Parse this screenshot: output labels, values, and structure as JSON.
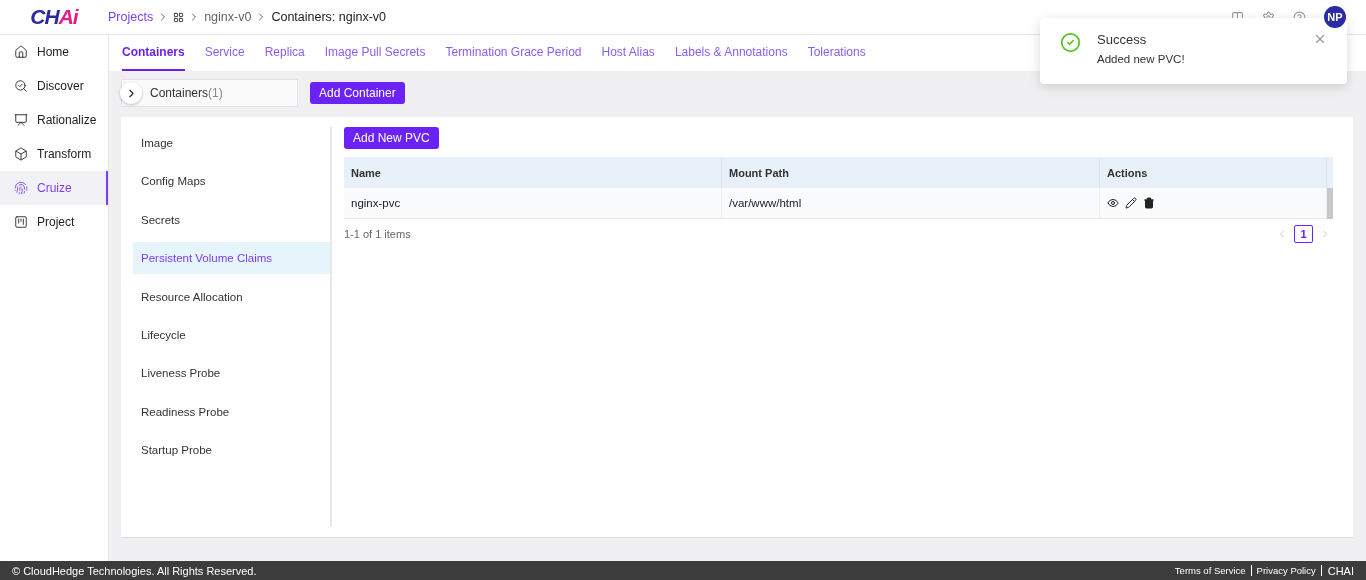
{
  "logo": {
    "main": "CH",
    "accent": "Ai"
  },
  "breadcrumb": [
    {
      "kind": "link",
      "label": "Projects"
    },
    {
      "kind": "grid"
    },
    {
      "kind": "muted",
      "label": "nginx-v0"
    },
    {
      "kind": "current",
      "label": "Containers: nginx-v0"
    }
  ],
  "user": {
    "initials": "NP"
  },
  "sidebar": {
    "items": [
      {
        "kind": "home",
        "label": "Home",
        "selected": false
      },
      {
        "kind": "discover",
        "label": "Discover",
        "selected": false
      },
      {
        "kind": "rationalize",
        "label": "Rationalize",
        "selected": false
      },
      {
        "kind": "transform",
        "label": "Transform",
        "selected": false
      },
      {
        "kind": "cruize",
        "label": "Cruize",
        "selected": true
      },
      {
        "kind": "project",
        "label": "Project",
        "selected": false
      }
    ]
  },
  "tabs": [
    {
      "label": "Containers",
      "selected": true
    },
    {
      "label": "Service",
      "selected": false
    },
    {
      "label": "Replica",
      "selected": false
    },
    {
      "label": "Image Pull Secrets",
      "selected": false
    },
    {
      "label": "Termination Grace Period",
      "selected": false
    },
    {
      "label": "Host Alias",
      "selected": false
    },
    {
      "label": "Labels & Annotations",
      "selected": false
    },
    {
      "label": "Tolerations",
      "selected": false
    }
  ],
  "containers_bar": {
    "label": "Containers",
    "count": "(1)",
    "add_button": "Add Container"
  },
  "sections": [
    {
      "label": "Image",
      "selected": false
    },
    {
      "label": "Config Maps",
      "selected": false
    },
    {
      "label": "Secrets",
      "selected": false
    },
    {
      "label": "Persistent Volume Claims",
      "selected": true
    },
    {
      "label": "Resource Allocation",
      "selected": false
    },
    {
      "label": "Lifecycle",
      "selected": false
    },
    {
      "label": "Liveness Probe",
      "selected": false
    },
    {
      "label": "Readiness Probe",
      "selected": false
    },
    {
      "label": "Startup Probe",
      "selected": false
    }
  ],
  "add_pvc": "Add New PVC",
  "table": {
    "columns": [
      "Name",
      "Mount Path",
      "Actions"
    ],
    "rows": [
      {
        "name": "nginx-pvc",
        "mount_path": "/var/www/html"
      }
    ]
  },
  "pagination": {
    "summary": "1-1 of 1 items",
    "pages": [
      {
        "label": "1",
        "selected": true
      }
    ]
  },
  "toast": {
    "kind": "success",
    "title": "Success",
    "message": "Added new PVC!"
  },
  "footer": {
    "copyright": "© CloudHedge Technologies. All Rights Reserved.",
    "links": [
      "Terms of Service",
      "Privacy Policy"
    ],
    "brand": "CHAI"
  }
}
